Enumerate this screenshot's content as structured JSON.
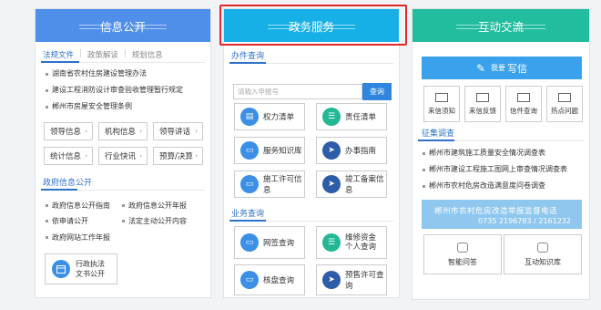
{
  "panel1": {
    "title": "信息公开",
    "tabs": [
      "法规文件",
      "政策解读",
      "规划信息"
    ],
    "tab_separator": "|",
    "items": [
      "湖南省农村住房建设管理办法",
      "建设工程消防设计审查验收管理暂行规定",
      "郴州市房屋安全管理条例"
    ],
    "buttons": [
      "领导信息",
      "机构信息",
      "领导讲话",
      "统计信息",
      "行业快讯",
      "预算/决算"
    ],
    "arrow": "›",
    "section_title": "政府信息公开",
    "links": [
      "政府信息公开指南",
      "政府信息公开年报",
      "依申请公开",
      "法定主动公开内容",
      "政府网站工作年报"
    ],
    "admin_button": [
      "行政执法",
      "文书公开"
    ]
  },
  "panel2": {
    "title": "政务服务",
    "section1_title": "办件查询",
    "search_placeholder": "请输入申报号",
    "search_button": "查询",
    "services": [
      {
        "label": "权力清单",
        "icon": "list-icon",
        "color": "blue"
      },
      {
        "label": "责任清单",
        "icon": "checklist-icon",
        "color": "green"
      },
      {
        "label": "服务知识库",
        "icon": "book-icon",
        "color": "blue"
      },
      {
        "label": "办事指南",
        "icon": "send-icon",
        "color": "navy"
      },
      {
        "label": "施工许可信息",
        "icon": "document-icon",
        "color": "blue"
      },
      {
        "label": "竣工备案信息",
        "icon": "send-icon",
        "color": "navy"
      }
    ],
    "section2_title": "业务查询",
    "business": [
      {
        "label": "网签查询",
        "icon": "document-icon",
        "color": "blue"
      },
      {
        "label1": "维修资金",
        "label2": "个人查询",
        "icon": "checklist-icon",
        "color": "green"
      },
      {
        "label": "核盘查询",
        "icon": "book-icon",
        "color": "blue"
      },
      {
        "label": "预售许可查询",
        "icon": "send-icon",
        "color": "navy"
      }
    ]
  },
  "panel3": {
    "title": "互动交流",
    "banner_small": "我要",
    "banner_text": "写信",
    "mail_buttons": [
      "来信须知",
      "来信反馈",
      "信件查询",
      "热点问题"
    ],
    "section_title": "征集调查",
    "surveys": [
      "郴州市建筑施工质量安全情况调查表",
      "郴州市建设工程施工图网上审查情况调查表",
      "郴州市农村危房改造满意度问卷调查"
    ],
    "image_banner_title": "郴州市农村危房改造举报监督电话",
    "image_banner_phone": "0735 2196783 / 2161232",
    "qa_buttons": [
      "智能问答",
      "互动知识库"
    ]
  },
  "colors": {
    "panel1_header": "#4f8ee9",
    "panel2_header": "#17b0e6",
    "panel3_header": "#21bd9e",
    "highlight_border": "#e02a2a",
    "link_blue": "#2e71c9"
  }
}
